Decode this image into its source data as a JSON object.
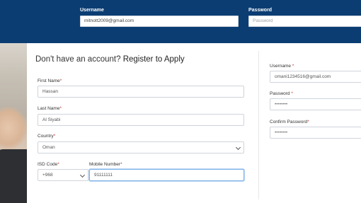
{
  "top_login": {
    "username_label": "Username",
    "username_value": "mitnott2009@gmail.com",
    "password_label": "Password",
    "password_placeholder": "Password"
  },
  "register": {
    "heading_prefix": "Don't have an account?",
    "heading_link": "Register to Apply",
    "first_name": {
      "label": "First Name",
      "value": "Hassan"
    },
    "last_name": {
      "label": "Last Name",
      "value": "Al Siyabi"
    },
    "country": {
      "label": "Country",
      "value": "Oman"
    },
    "isd_code": {
      "label": "ISD Code",
      "value": "+968"
    },
    "mobile": {
      "label": "Mobile Number",
      "value": "91111111"
    },
    "required_marker": "*"
  },
  "account": {
    "username": {
      "label": "Username",
      "value": "omani1234516@gmail.com"
    },
    "password": {
      "label": "Password",
      "value": "••••••••"
    },
    "confirm_password": {
      "label": "Confirm Password",
      "value": "••••••••"
    }
  },
  "colors": {
    "header_bg": "#0b3d73",
    "required": "#c0392b",
    "focus": "#7fb2e8"
  }
}
